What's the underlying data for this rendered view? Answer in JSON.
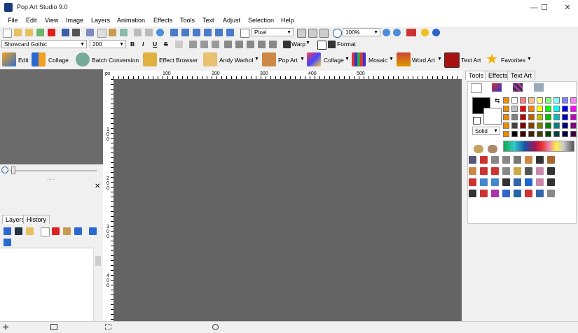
{
  "window": {
    "title": "Pop Art Studio 9.0",
    "minimize": "—",
    "maximize": "☐",
    "close": "✕"
  },
  "menu": [
    "File",
    "Edit",
    "View",
    "Image",
    "Layers",
    "Animation",
    "Effects",
    "Tools",
    "Text",
    "Adjust",
    "Selection",
    "Help"
  ],
  "toolbar1": {
    "unit_value": "Pixel",
    "zoom_value": "100%"
  },
  "toolbar2": {
    "font_value": "Showcard Gothic",
    "size_value": "200",
    "bold": "B",
    "italic": "I",
    "underline": "U",
    "strike": "S",
    "warp_label": "Warp",
    "format_label": "Format"
  },
  "toolbar3": {
    "edit": "Edit",
    "collage": "Collage",
    "batch": "Batch Conversion",
    "effect_browser": "Effect Browser",
    "andy_warhol": "Andy Warhol",
    "pop_art": "Pop Art",
    "collage2": "Collage",
    "mosaic": "Mosaic",
    "word_art": "Word Art",
    "text_art": "Text Art",
    "favorites": "Favorites"
  },
  "ruler": {
    "unit": "px",
    "h_labels": [
      "100",
      "200",
      "300",
      "400",
      "500"
    ],
    "v_labels": [
      "1\n0\n0",
      "2\n0\n0",
      "3\n0\n0",
      "4\n0\n0"
    ]
  },
  "left_panel": {
    "tabs": [
      "Layers",
      "History"
    ],
    "close": "✕",
    "dots": "....."
  },
  "right_panel": {
    "tabs": [
      "Tools",
      "Effects",
      "Text Art"
    ],
    "fill_mode": "Solid",
    "palette_colors": [
      [
        "#ffffff",
        "#ff8080",
        "#ffc080",
        "#ffff80",
        "#80ff80",
        "#80ffff",
        "#8080ff",
        "#ff80ff"
      ],
      [
        "#c0c0c0",
        "#ff0000",
        "#ff8000",
        "#ffff00",
        "#00ff00",
        "#00ffff",
        "#0000ff",
        "#ff00ff"
      ],
      [
        "#808080",
        "#c00000",
        "#c06000",
        "#c0c000",
        "#00c000",
        "#00c0c0",
        "#0000c0",
        "#c000c0"
      ],
      [
        "#404040",
        "#800000",
        "#804000",
        "#808000",
        "#008000",
        "#008080",
        "#000080",
        "#800080"
      ],
      [
        "#000000",
        "#400000",
        "#402000",
        "#404000",
        "#004000",
        "#004040",
        "#000040",
        "#400040"
      ]
    ],
    "recent_colors": [
      "#f08c00",
      "#f08c00",
      "#f08c00",
      "#f08c00",
      "#f08c00"
    ],
    "foreground": "#000000",
    "background": "#ffffff"
  }
}
